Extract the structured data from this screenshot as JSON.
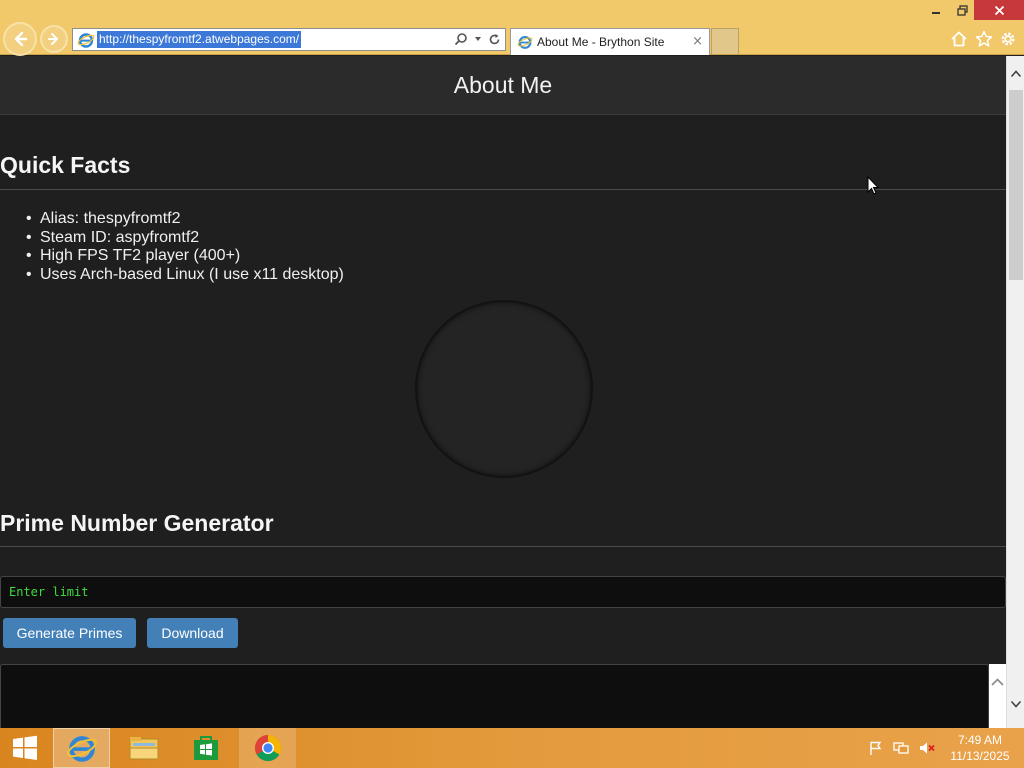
{
  "browser": {
    "url": "http://thespyfromtf2.atwebpages.com/",
    "tab_title": "About Me - Brython Site",
    "tab_close": "×"
  },
  "page": {
    "title": "About Me",
    "quick_facts": {
      "heading": "Quick Facts",
      "items": [
        "Alias: thespyfromtf2",
        "Steam ID: aspyfromtf2",
        "High FPS TF2 player (400+)",
        "Uses Arch-based Linux (I use x11 desktop)"
      ]
    },
    "prime_generator": {
      "heading": "Prime Number Generator",
      "input_placeholder": "Enter limit",
      "generate_label": "Generate Primes",
      "download_label": "Download"
    }
  },
  "taskbar": {
    "time": "7:49 AM",
    "date": "11/13/2025"
  },
  "colors": {
    "chrome_bg": "#f1c86a",
    "page_bg": "#1f1f1f",
    "header_bg": "#2b2b2b",
    "button_bg": "#4380b8",
    "input_text": "#3fdc3f",
    "taskbar_bg": "#e39a3c"
  }
}
